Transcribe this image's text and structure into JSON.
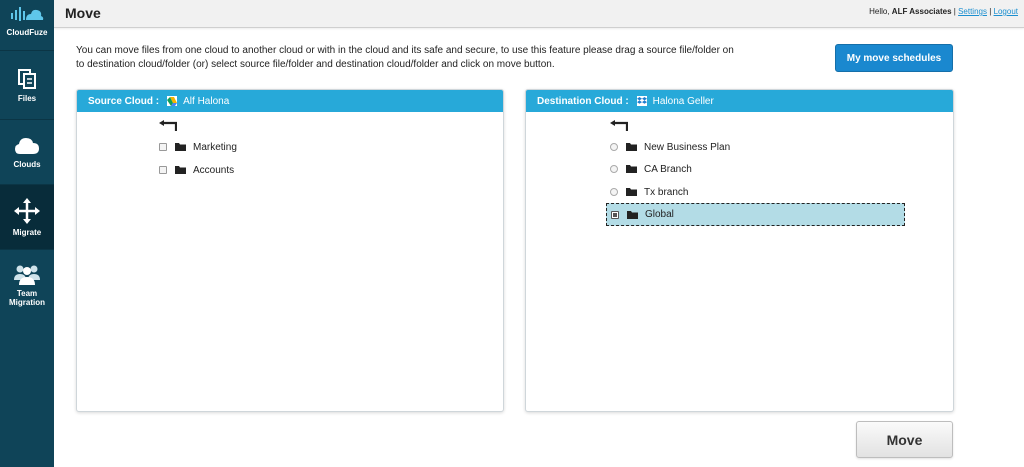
{
  "brand": {
    "name": "CloudFuze",
    "icon": "cloudfuze-logo-icon"
  },
  "nav": [
    {
      "label": "Files",
      "icon": "files-icon",
      "active": false
    },
    {
      "label": "Clouds",
      "icon": "cloud-icon",
      "active": false
    },
    {
      "label": "Migrate",
      "icon": "move-arrows-icon",
      "active": true
    },
    {
      "label": "Team Migration",
      "icon": "team-icon",
      "active": false
    }
  ],
  "header": {
    "title": "Move",
    "greeting": "Hello,",
    "user": "ALF Associates",
    "separator": "|",
    "settings": "Settings",
    "logout": "Logout"
  },
  "description": "You can move files from one cloud to another cloud or with in the cloud and its safe and secure, to use this feature please drag a source file/folder on to destination cloud/folder (or) select source file/folder and destination cloud/folder and click on move button.",
  "schedules_button": "My move schedules",
  "source": {
    "heading": "Source Cloud :",
    "account": "Alf Halona",
    "account_icon": "google-drive-icon",
    "items": [
      {
        "name": "Marketing",
        "checked": false
      },
      {
        "name": "Accounts",
        "checked": false
      }
    ]
  },
  "destination": {
    "heading": "Destination Cloud :",
    "account": "Halona Geller",
    "account_icon": "dropbox-icon",
    "items": [
      {
        "name": "New Business Plan",
        "selected": false
      },
      {
        "name": "CA Branch",
        "selected": false
      },
      {
        "name": "Tx branch",
        "selected": false
      },
      {
        "name": "Global",
        "selected": true
      }
    ]
  },
  "move_button": "Move",
  "colors": {
    "sidebar": "#0f4458",
    "sidebar_active": "#082c3a",
    "panel_header": "#27a9d9",
    "primary_button": "#1a88cf",
    "link": "#1b8fd0",
    "selected_row": "#b3dce6"
  }
}
